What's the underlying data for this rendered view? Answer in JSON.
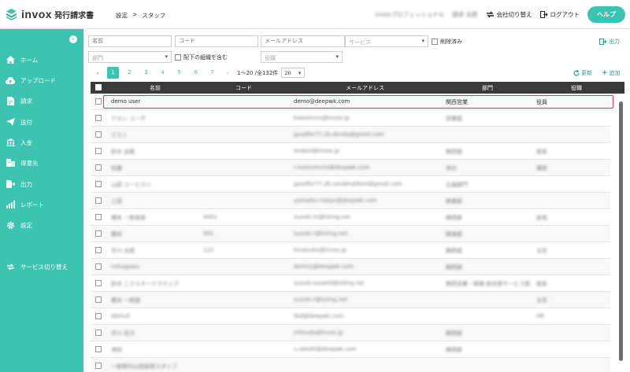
{
  "app": {
    "logo": "invox",
    "subtitle": "発行請求書"
  },
  "breadcrumb": [
    "設定",
    ">",
    "スタッフ"
  ],
  "header": {
    "org": "invoxプロフェッショナル",
    "user": "請求 太郎",
    "switch_company": "会社切り替え",
    "logout": "ログアウト",
    "help": "ヘルプ"
  },
  "sidebar": {
    "items": [
      {
        "label": "ホーム",
        "icon": "home-icon"
      },
      {
        "label": "アップロード",
        "icon": "cloud-upload-icon"
      },
      {
        "label": "請求",
        "icon": "document-icon"
      },
      {
        "label": "送付",
        "icon": "send-icon"
      },
      {
        "label": "入金",
        "icon": "bank-icon"
      },
      {
        "label": "得意先",
        "icon": "building-icon"
      },
      {
        "label": "出力",
        "icon": "export-icon"
      },
      {
        "label": "レポート",
        "icon": "chart-icon"
      },
      {
        "label": "設定",
        "icon": "gear-icon"
      }
    ],
    "service_switch": "サービス切り替え"
  },
  "filters": {
    "name_placeholder": "名前",
    "code_placeholder": "コード",
    "email_placeholder": "メールアドレス",
    "service_placeholder": "サービス",
    "deleted_label": "削除済み",
    "dept_placeholder": "部門",
    "include_sub_label": "配下の組織を含む",
    "role_placeholder": "役職",
    "export_label": "出力"
  },
  "pagination": {
    "pages": [
      "1",
      "2",
      "3",
      "4",
      "5",
      "6",
      "7"
    ],
    "range": "1〜20 /全132件",
    "per_page": "20",
    "refresh": "更新",
    "add": "追加"
  },
  "table": {
    "columns": [
      "名前",
      "コード",
      "メールアドレス",
      "部門",
      "役職"
    ],
    "rows": [
      {
        "name": "demo user",
        "code": "",
        "email": "demo@deepwk.com",
        "dept": "関西営業",
        "role": "役員"
      },
      {
        "name": "アカシ ユーザ",
        "code": "",
        "email": "kawamura@invox.jp",
        "dept": "営業部",
        "role": ""
      },
      {
        "name": "テスト",
        "code": "",
        "email": "goodfor77.2b.denda@gmail.com",
        "dept": "",
        "role": ""
      },
      {
        "name": "鈴木 由美",
        "code": "",
        "email": "hodani@invox.jp",
        "dept": "関西部",
        "role": "部長"
      },
      {
        "name": "佐藤",
        "code": "",
        "email": "r.matsumura@deepwk.com",
        "dept": "本社",
        "role": "課長"
      },
      {
        "name": "山田 ユーヒカリ",
        "code": "",
        "email": "goodfor77.2b.sandmailbon@gmail.com",
        "dept": "企画部門",
        "role": ""
      },
      {
        "name": "上田",
        "code": "",
        "email": "yamada.r.tokyo@deepwk.com",
        "dept": "関東部",
        "role": ""
      },
      {
        "name": "橋本 一郎部長",
        "code": "0001",
        "email": "suzuki.m@tsting.net",
        "dept": "関西部",
        "role": "部長"
      },
      {
        "name": "橋本",
        "code": "001",
        "email": "suzuki.r@tsting.net",
        "dept": "関東部",
        "role": ""
      },
      {
        "name": "平川 太郎",
        "code": "123",
        "email": "hiratsuka@invox.jp",
        "dept": "関西部",
        "role": "主任"
      },
      {
        "name": "nakagawa",
        "code": "",
        "email": "demo1@deepwk.com",
        "dept": "関西部",
        "role": ""
      },
      {
        "name": "鈴木 こさらオーテラテンブ",
        "code": "",
        "email": "suzuki.sasami@tsting.net",
        "dept": "関西営業・経理 総合部サービス部",
        "role": "部長"
      },
      {
        "name": "橋本 一郎部",
        "code": "",
        "email": "suzuki.r@tsting.net",
        "dept": "",
        "role": "主任"
      },
      {
        "name": "ebmull",
        "code": "",
        "email": "tbd@deepwk.com",
        "dept": "",
        "role": "HR"
      },
      {
        "name": "平川 花子",
        "code": "",
        "email": "mitsuda@invox.jp",
        "dept": "関西部",
        "role": ""
      },
      {
        "name": "津田",
        "code": "",
        "email": "s.ukeshi@deepwk.com",
        "dept": "関西部",
        "role": ""
      },
      {
        "name": "一般部内山田仮想スタッフ",
        "code": "",
        "email": "",
        "dept": "",
        "role": ""
      }
    ]
  },
  "colors": {
    "accent": "#3cc3b2",
    "header": "#3a3a3a",
    "highlight": "#d6336c"
  }
}
